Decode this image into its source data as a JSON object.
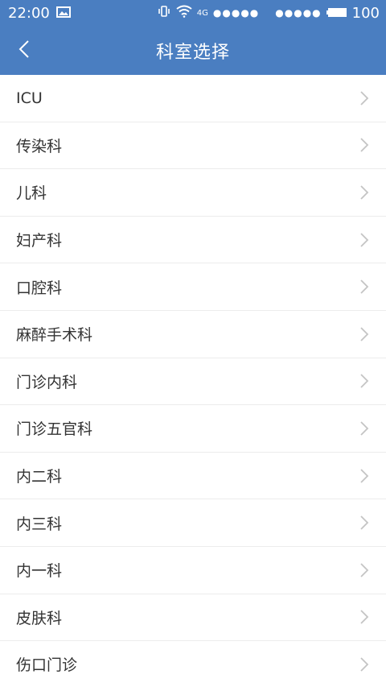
{
  "status_bar": {
    "time": "22:00",
    "network": "4G",
    "signal_dots_1": "●●●●●",
    "signal_dots_2": "●●●●●",
    "battery": "100"
  },
  "header": {
    "title": "科室选择",
    "back_icon": "chevron-left-icon"
  },
  "departments": [
    "ICU",
    "传染科",
    "儿科",
    "妇产科",
    "口腔科",
    "麻醉手术科",
    "门诊内科",
    "门诊五官科",
    "内二科",
    "内三科",
    "内一科",
    "皮肤科",
    "伤口门诊"
  ],
  "colors": {
    "header_bg": "#4a7ec1",
    "divider": "#ececec",
    "text": "#333333",
    "chevron": "#c4c4c4"
  }
}
